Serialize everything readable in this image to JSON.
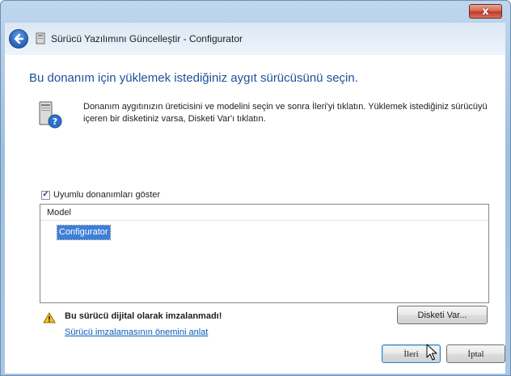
{
  "window": {
    "title": "Sürücü Yazılımını Güncelleştir - Configurator",
    "close_label": "x"
  },
  "icons": {
    "back": "back-arrow-icon",
    "app": "device-icon",
    "info": "computer-help-icon",
    "warning": "warning-icon",
    "cursor": "mouse-pointer-icon"
  },
  "main": {
    "heading": "Bu donanım için yüklemek istediğiniz aygıt sürücüsünü seçin.",
    "instruction": "Donanım aygıtınızın üreticisini ve modelini seçin ve sonra İleri'yi tıklatın. Yüklemek istediğiniz sürücüyü içeren bir disketiniz varsa, Disketi Var'ı tıklatın."
  },
  "compat": {
    "label": "Uyumlu donanımları göster",
    "checked": true
  },
  "model_list": {
    "header": "Model",
    "items": [
      "Configurator"
    ],
    "selected": "Configurator"
  },
  "warning": {
    "text": "Bu sürücü dijital olarak imzalanmadı!",
    "link": "Sürücü imzalamasının önemini anlat"
  },
  "buttons": {
    "have_disk": "Disketi Var...",
    "next": "İleri",
    "cancel": "İptal"
  },
  "colors": {
    "heading": "#1f4f9a",
    "link": "#0b5bb7",
    "selection": "#3d7fd6",
    "close": "#c0392b"
  }
}
